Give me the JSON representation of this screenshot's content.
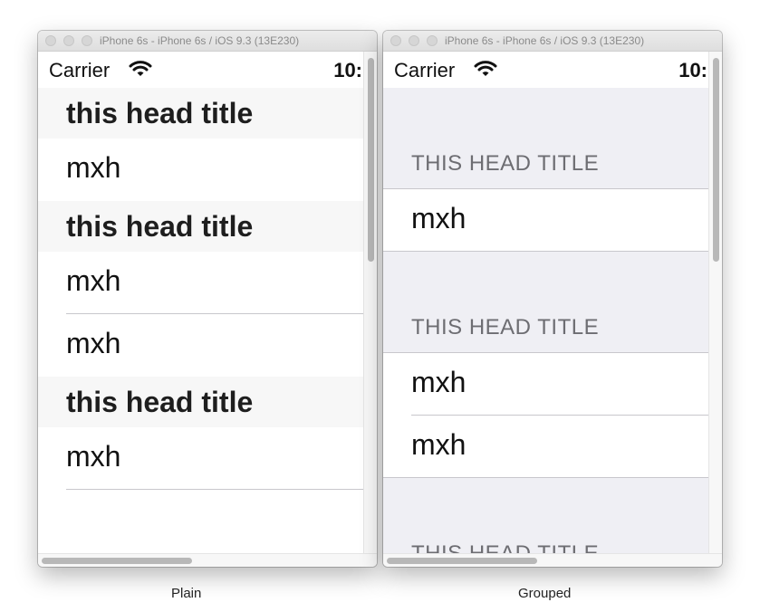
{
  "windows": {
    "plain": {
      "title": "iPhone 6s - iPhone 6s / iOS 9.3 (13E230)"
    },
    "grouped": {
      "title": "iPhone 6s - iPhone 6s / iOS 9.3 (13E230)"
    }
  },
  "status_bar": {
    "carrier": "Carrier",
    "time": "10:"
  },
  "plain": {
    "section_title": "this head title",
    "cell_label": "mxh"
  },
  "grouped": {
    "section_title": "THIS HEAD TITLE",
    "cell_label": "mxh"
  },
  "captions": {
    "plain": "Plain",
    "grouped": "Grouped"
  },
  "colors": {
    "plain_header_bg": "#f7f7f7",
    "grouped_bg": "#efeff4",
    "separator": "#c8c7cc",
    "grouped_header_text": "#6d6d72"
  }
}
